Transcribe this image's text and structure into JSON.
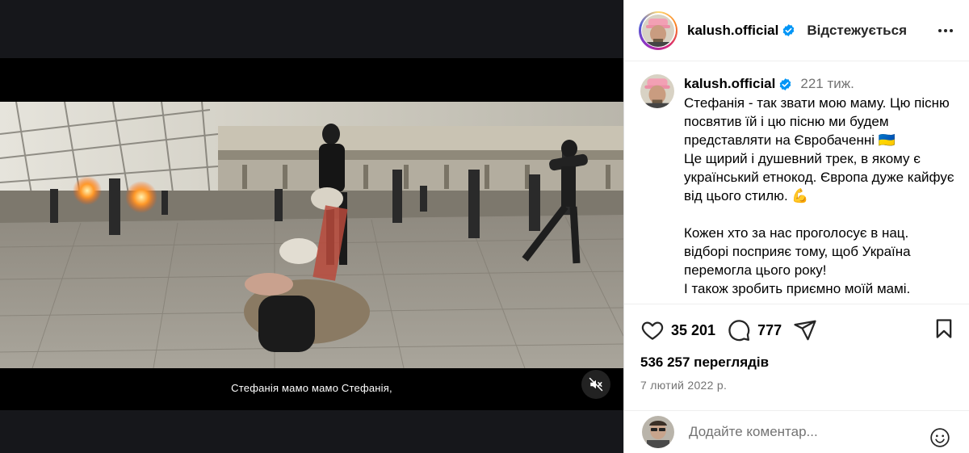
{
  "post": {
    "username": "kalush.official",
    "verified": true,
    "follow_state": "Відстежується",
    "more_icon": "more-horizontal-icon"
  },
  "caption": {
    "username": "kalush.official",
    "time_ago": "221 тиж.",
    "paragraph_1": "Стефанія - так звати мою маму. Цю пісню посвятив їй і цю пісню ми будем представляти на Євробаченні 🇺🇦\nЦе щирий і душевний трек, в якому є український етнокод. Європа дуже кайфує від цього стилю. 💪",
    "paragraph_2": "Кожен хто за нас проголосує в нац. відборі посприяє тому, щоб Україна перемогла цього року!\nІ також зробить приємно моїй мамі."
  },
  "video": {
    "subtitle": "Стефанія мамо мамо Стефанія,",
    "mute_icon": "speaker-muted-icon"
  },
  "stats": {
    "likes": "35 201",
    "comments": "777",
    "views": "536 257 переглядів",
    "date": "7 лютий 2022 р."
  },
  "comment_box": {
    "placeholder": "Додайте коментар...",
    "emoji_icon": "smiley-icon"
  },
  "colors": {
    "verified_blue": "#0095f6",
    "muted_text": "#737373",
    "divider": "#efefef"
  }
}
